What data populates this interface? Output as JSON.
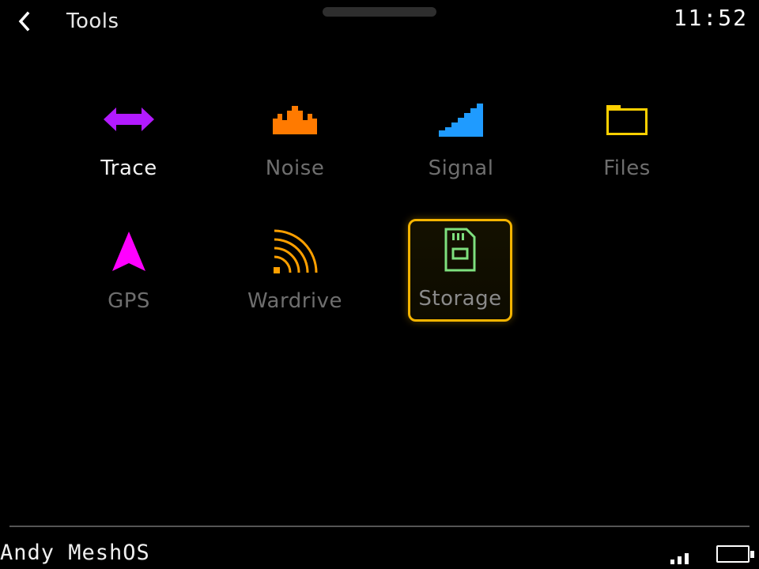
{
  "header": {
    "title": "Tools",
    "clock": "11:52",
    "back_icon": "chevron-left-icon"
  },
  "tools": [
    {
      "label": "Trace",
      "icon": "double-arrow-icon",
      "color": "#b21aff"
    },
    {
      "label": "Noise",
      "icon": "crown-icon",
      "color": "#ff7a00"
    },
    {
      "label": "Signal",
      "icon": "signal-ramp-icon",
      "color": "#1f9bff"
    },
    {
      "label": "Files",
      "icon": "folder-icon",
      "color": "#ffd000"
    },
    {
      "label": "GPS",
      "icon": "arrow-up-icon",
      "color": "#ff00ff"
    },
    {
      "label": "Wardrive",
      "icon": "wifi-arc-icon",
      "color": "#ffa000"
    },
    {
      "label": "Storage",
      "icon": "sd-card-icon",
      "color": "#7ee07e"
    }
  ],
  "focus_color": "#f5b400",
  "footer": {
    "device_name": "Andy MeshOS"
  }
}
